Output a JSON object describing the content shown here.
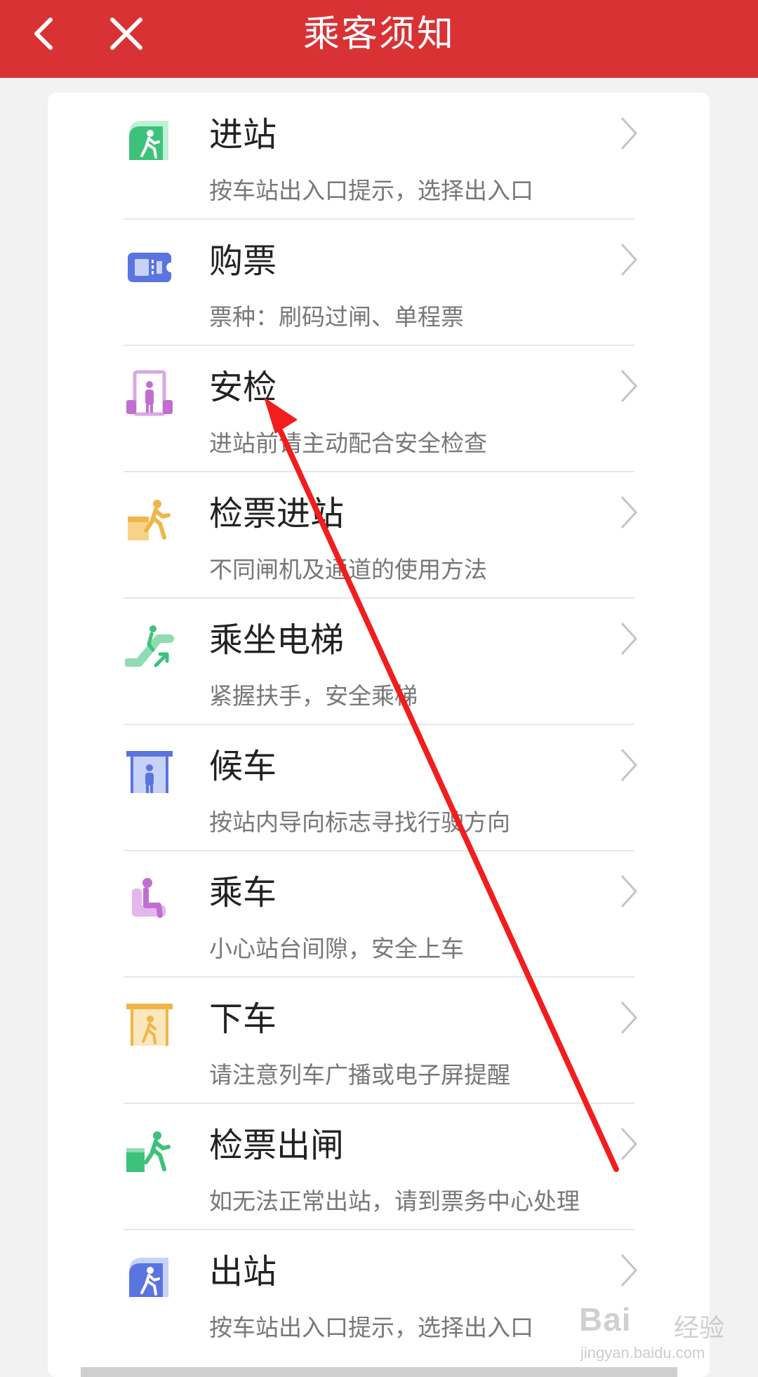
{
  "header": {
    "title": "乘客须知",
    "back_icon": "chevron-left-icon",
    "close_icon": "close-icon",
    "bg_color": "#d83235"
  },
  "items": [
    {
      "label": "进站",
      "desc": "按车站出入口提示，选择出入口",
      "icon": "station-entrance-icon",
      "color": "#3cc27a"
    },
    {
      "label": "购票",
      "desc": "票种：刷码过闸、单程票",
      "icon": "ticket-icon",
      "color": "#5a74e0"
    },
    {
      "label": "安检",
      "desc": "进站前请主动配合安全检查",
      "icon": "security-check-icon",
      "color": "#c06fd0"
    },
    {
      "label": "检票进站",
      "desc": "不同闸机及通道的使用方法",
      "icon": "ticket-gate-entry-icon",
      "color": "#f0b54a"
    },
    {
      "label": "乘坐电梯",
      "desc": "紧握扶手，安全乘梯",
      "icon": "escalator-icon",
      "color": "#3cc27a"
    },
    {
      "label": "候车",
      "desc": "按站内导向标志寻找行驶方向",
      "icon": "waiting-icon",
      "color": "#5a74e0"
    },
    {
      "label": "乘车",
      "desc": "小心站台间隙，安全上车",
      "icon": "seat-icon",
      "color": "#c06fd0"
    },
    {
      "label": "下车",
      "desc": "请注意列车广播或电子屏提醒",
      "icon": "alight-icon",
      "color": "#f0b54a"
    },
    {
      "label": "检票出闸",
      "desc": "如无法正常出站，请到票务中心处理",
      "icon": "ticket-gate-exit-icon",
      "color": "#3cc27a"
    },
    {
      "label": "出站",
      "desc": "按车站出入口提示，选择出入口",
      "icon": "station-exit-icon",
      "color": "#5a74e0"
    }
  ],
  "annotation": {
    "color": "#f21d1d"
  },
  "watermark": {
    "brand": "Bai",
    "cn": "经验",
    "url": "jingyan.baidu.com"
  }
}
